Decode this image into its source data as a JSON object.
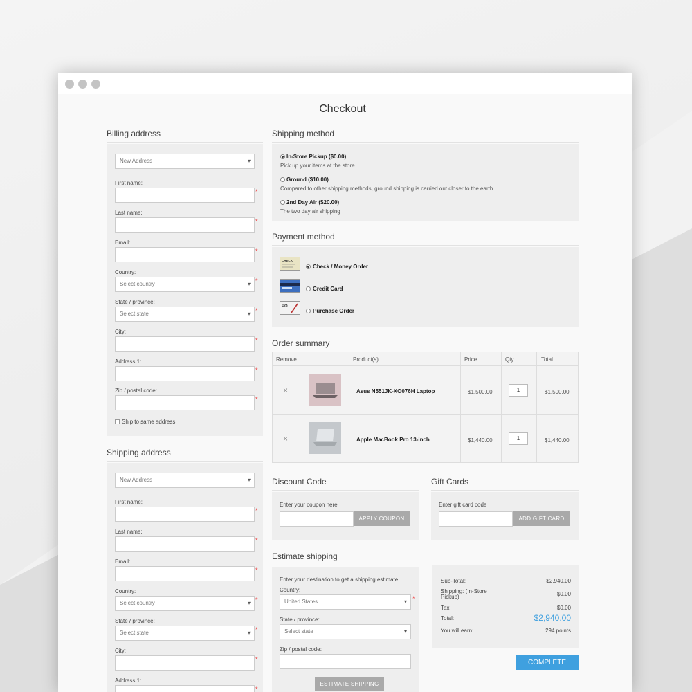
{
  "title": "Checkout",
  "billing": {
    "heading": "Billing address",
    "address_select": "New Address",
    "first_name_label": "First name:",
    "last_name_label": "Last name:",
    "email_label": "Email:",
    "country_label": "Country:",
    "country_select": "Select country",
    "state_label": "State / province:",
    "state_select": "Select state",
    "city_label": "City:",
    "address1_label": "Address 1:",
    "zip_label": "Zip / postal code:",
    "ship_same_label": "Ship to same address"
  },
  "shipping_address": {
    "heading": "Shipping address",
    "address_select": "New Address",
    "first_name_label": "First name:",
    "last_name_label": "Last name:",
    "email_label": "Email:",
    "country_label": "Country:",
    "country_select": "Select country",
    "state_label": "State / province:",
    "state_select": "Select state",
    "city_label": "City:",
    "address1_label": "Address 1:"
  },
  "shipping_method": {
    "heading": "Shipping method",
    "options": [
      {
        "label": "In-Store Pickup ($0.00)",
        "desc": "Pick up your items at the store",
        "selected": true
      },
      {
        "label": "Ground ($10.00)",
        "desc": "Compared to other shipping methods, ground shipping is carried out closer to the earth",
        "selected": false
      },
      {
        "label": "2nd Day Air ($20.00)",
        "desc": "The two day air shipping",
        "selected": false
      }
    ]
  },
  "payment_method": {
    "heading": "Payment method",
    "options": [
      {
        "label": "Check / Money Order",
        "icon": "check-icon",
        "selected": true
      },
      {
        "label": "Credit Card",
        "icon": "credit-card-icon",
        "selected": false
      },
      {
        "label": "Purchase Order",
        "icon": "purchase-order-icon",
        "selected": false
      }
    ]
  },
  "order_summary": {
    "heading": "Order summary",
    "columns": [
      "Remove",
      "",
      "Product(s)",
      "Price",
      "Qty.",
      "Total"
    ],
    "rows": [
      {
        "product": "Asus N551JK-XO076H Laptop",
        "price": "$1,500.00",
        "qty": "1",
        "total": "$1,500.00",
        "remove": "×"
      },
      {
        "product": "Apple MacBook Pro 13-inch",
        "price": "$1,440.00",
        "qty": "1",
        "total": "$1,440.00",
        "remove": "×"
      }
    ]
  },
  "discount": {
    "heading": "Discount Code",
    "hint": "Enter your coupon here",
    "button": "APPLY COUPON"
  },
  "gift": {
    "heading": "Gift Cards",
    "hint": "Enter gift card code",
    "button": "ADD GIFT CARD"
  },
  "estimate": {
    "heading": "Estimate shipping",
    "hint": "Enter your destination to get a shipping estimate",
    "country_label": "Country:",
    "country_select": "United States",
    "state_label": "State / province:",
    "state_select": "Select state",
    "zip_label": "Zip / postal code:",
    "button": "ESTIMATE SHIPPING"
  },
  "totals": {
    "subtotal_label": "Sub-Total:",
    "subtotal": "$2,940.00",
    "shipping_label_1": "Shipping: (In-Store",
    "shipping_label_2": "Pickup)",
    "shipping": "$0.00",
    "tax_label": "Tax:",
    "tax": "$0.00",
    "total_label": "Total:",
    "total": "$2,940.00",
    "earn_label": "You will earn:",
    "earn": "294 points"
  },
  "complete_button": "COMPLETE",
  "colors": {
    "accent": "#3fa0df",
    "button_gray": "#a9a9a9",
    "required": "#ee4444"
  }
}
